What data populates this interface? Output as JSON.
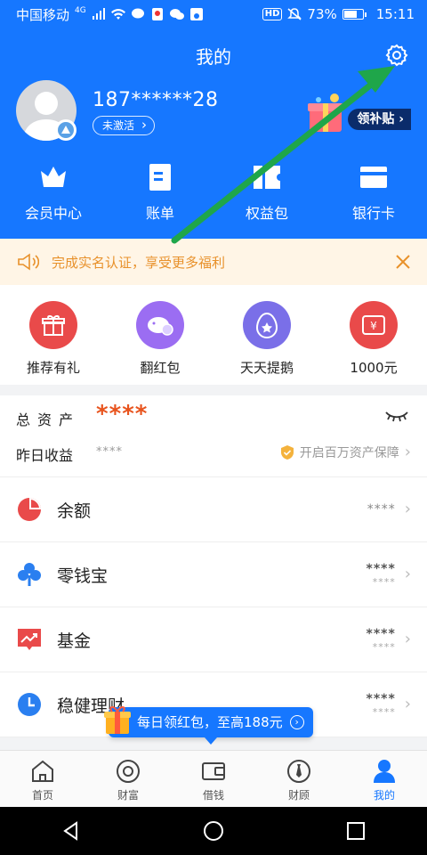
{
  "status_bar": {
    "carrier": "中国移动",
    "network": "4G",
    "battery_percent": "73%",
    "time": "15:11",
    "hd_label": "HD"
  },
  "header": {
    "title": "我的",
    "phone": "187******28",
    "account_status": "未激活",
    "subsidy_label": "领补贴",
    "quick_items": [
      {
        "label": "会员中心",
        "icon": "crown-icon"
      },
      {
        "label": "账单",
        "icon": "bill-icon"
      },
      {
        "label": "权益包",
        "icon": "ticket-icon"
      },
      {
        "label": "银行卡",
        "icon": "bank-card-icon"
      }
    ]
  },
  "notice": {
    "text": "完成实名认证，享受更多福利"
  },
  "activities": [
    {
      "label": "推荐有礼",
      "icon": "gift-icon",
      "color": "#e94a4a"
    },
    {
      "label": "翻红包",
      "icon": "piggy-icon",
      "color": "#9b6df2"
    },
    {
      "label": "天天提鹅",
      "icon": "egg-star-icon",
      "color": "#7a6fe8"
    },
    {
      "label": "1000元",
      "icon": "coupon-icon",
      "color": "#e94a4a"
    }
  ],
  "assets": {
    "total_label": "总资产",
    "total_value": "****",
    "yesterday_label": "昨日收益",
    "yesterday_value": "****",
    "protection_text": "开启百万资产保障"
  },
  "products": [
    {
      "label": "余额",
      "icon": "pie-icon",
      "value": "****",
      "subvalue": ""
    },
    {
      "label": "零钱宝",
      "icon": "clover-icon",
      "value": "****",
      "subvalue": "****"
    },
    {
      "label": "基金",
      "icon": "trend-icon",
      "value": "****",
      "subvalue": "****"
    },
    {
      "label": "稳健理财",
      "icon": "clock-icon",
      "value": "****",
      "subvalue": "****"
    }
  ],
  "promo": {
    "text": "每日领红包，至高188元"
  },
  "tabs": [
    {
      "label": "首页",
      "icon": "home-icon"
    },
    {
      "label": "财富",
      "icon": "wealth-icon"
    },
    {
      "label": "借钱",
      "icon": "wallet-icon"
    },
    {
      "label": "财顾",
      "icon": "advisor-icon"
    },
    {
      "label": "我的",
      "icon": "profile-icon",
      "active": true
    }
  ],
  "colors": {
    "brand": "#1677ff",
    "notice_text": "#e8912b",
    "asset_stars": "#e8541e",
    "annotation_arrow": "#1fa64a"
  }
}
